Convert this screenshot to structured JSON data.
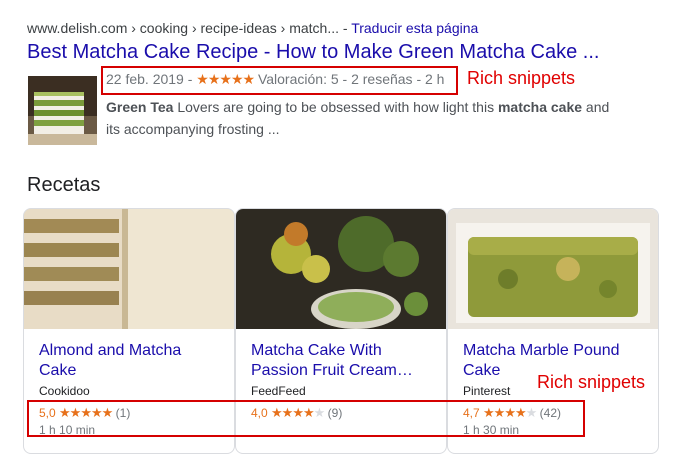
{
  "result": {
    "url": "www.delish.com › cooking › recipe-ideas › match...",
    "url_sep": " - ",
    "translate": "Traducir esta página",
    "title": "Best Matcha Cake Recipe - How to Make Green Matcha Cake ...",
    "date": "22 feb. 2019 - ",
    "stars": "★★★★★",
    "rating_text": " Valoración: 5 - 2 reseñas - 2 h",
    "snippet_bold1": "Green Tea",
    "snippet_mid": " Lovers are going to be obsessed with how light this ",
    "snippet_bold2": "matcha cake",
    "snippet_end": " and its accompanying frosting ..."
  },
  "annotations": {
    "label_top": "Rich snippets",
    "label_bottom": "Rich snippets",
    "color": "#e00000"
  },
  "section": {
    "title": "Recetas"
  },
  "recipes": [
    {
      "title": "Almond and Matcha Cake",
      "source": "Cookidoo",
      "rating": "5,0",
      "stars_full": "★★★★★",
      "stars_rest": "",
      "reviews": "(1)",
      "time": "1 h 10 min"
    },
    {
      "title": "Matcha Cake With Passion Fruit Cream…",
      "source": "FeedFeed",
      "rating": "4,0",
      "stars_full": "★★★★",
      "stars_rest": "★",
      "reviews": "(9)",
      "time": ""
    },
    {
      "title": "Matcha Marble Pound Cake",
      "source": "Pinterest",
      "rating": "4,7",
      "stars_full": "★★★★",
      "stars_rest": "★",
      "reviews": "(42)",
      "time": "1 h 30 min"
    }
  ],
  "colors": {
    "link": "#1a0dab",
    "star": "#e7711b",
    "annotation": "#d50000"
  }
}
